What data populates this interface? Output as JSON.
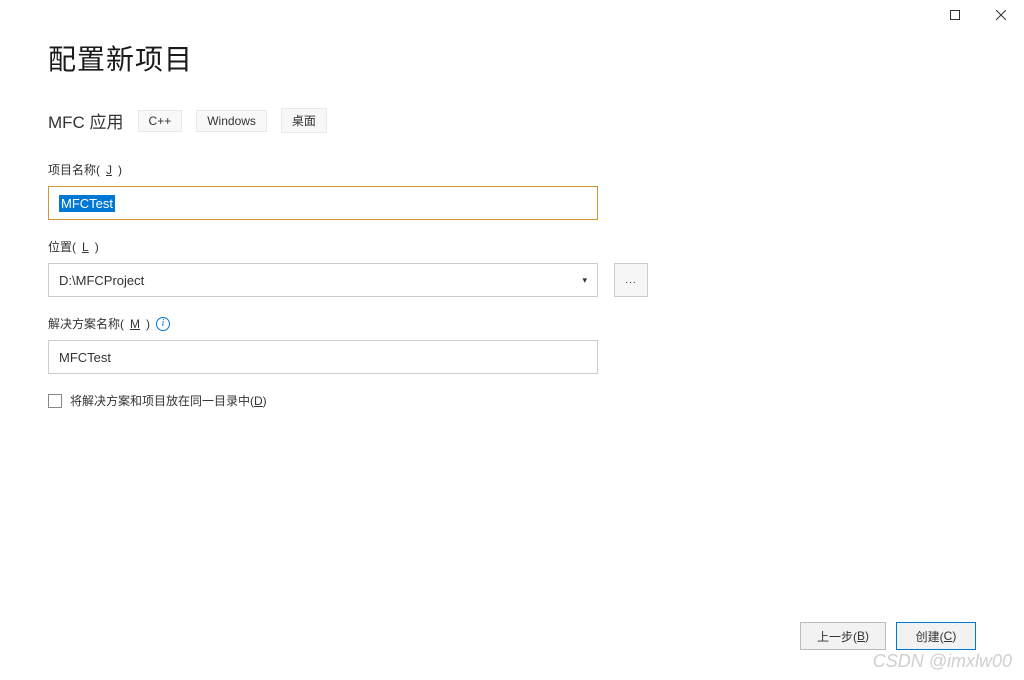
{
  "window": {
    "title": "配置新项目"
  },
  "subtitle": {
    "template_name": "MFC 应用",
    "tags": [
      "C++",
      "Windows",
      "桌面"
    ]
  },
  "fields": {
    "project_name": {
      "label_prefix": "项目名称(",
      "label_key": "J",
      "label_suffix": ")",
      "value": "MFCTest"
    },
    "location": {
      "label_prefix": "位置(",
      "label_key": "L",
      "label_suffix": ")",
      "value": "D:\\MFCProject",
      "browse_label": "..."
    },
    "solution_name": {
      "label_prefix": "解决方案名称(",
      "label_key": "M",
      "label_suffix": ")",
      "value": "MFCTest"
    },
    "same_dir_checkbox": {
      "label_prefix": "将解决方案和项目放在同一目录中(",
      "label_key": "D",
      "label_suffix": ")",
      "checked": false
    }
  },
  "footer": {
    "back_prefix": "上一步(",
    "back_key": "B",
    "back_suffix": ")",
    "create_prefix": "创建(",
    "create_key": "C",
    "create_suffix": ")"
  },
  "watermark": "CSDN @imxlw00"
}
